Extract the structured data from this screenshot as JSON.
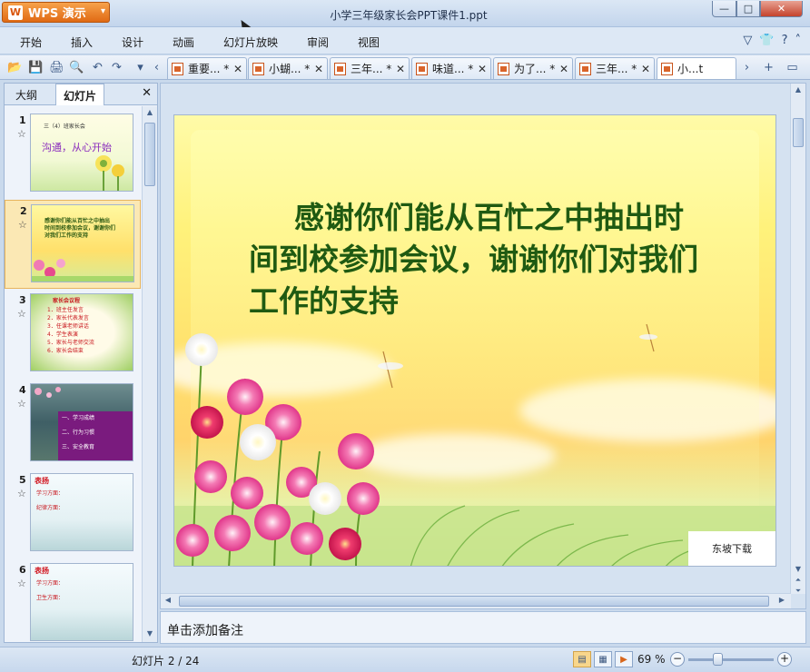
{
  "window": {
    "app_button": "WPS 演示",
    "app_logo": "W",
    "title": "小学三年级家长会PPT课件1.ppt",
    "min_glyph": "—",
    "max_glyph": "□",
    "close_glyph": "✕"
  },
  "menu": {
    "items": [
      "开始",
      "插入",
      "设计",
      "动画",
      "幻灯片放映",
      "审阅",
      "视图"
    ],
    "right_icons": [
      "dropdown-icon",
      "shirt-skin-icon",
      "help-icon",
      "caret-icon"
    ]
  },
  "toolbar": {
    "tabs": [
      {
        "label": "重要... *",
        "active": false
      },
      {
        "label": "小蝴... *",
        "active": false
      },
      {
        "label": "三年... *",
        "active": false
      },
      {
        "label": "味道... *",
        "active": false
      },
      {
        "label": "为了... *",
        "active": false
      },
      {
        "label": "三年... *",
        "active": false
      },
      {
        "label": "小...t",
        "active": true
      }
    ],
    "close_glyph": "✕"
  },
  "panel": {
    "tab_outline": "大纲",
    "tab_slides": "幻灯片",
    "close_glyph": "✕",
    "thumbnails": [
      {
        "num": "1",
        "lines": [
          "三（4）班家长会",
          "沟通，从心开始"
        ]
      },
      {
        "num": "2",
        "lines": [
          "感谢你们能从百忙之中抽出",
          "时间到校参加会议，谢谢你们",
          "对我们工作的支持"
        ]
      },
      {
        "num": "3",
        "lines": [
          "家长会议程",
          "1．班主任发言",
          "2．家长代表发言",
          "3．任课老师讲话",
          "4．学生表演",
          "5．家长与老师交流",
          "6．家长会结束"
        ]
      },
      {
        "num": "4",
        "lines": [
          "一、学习成绩",
          "二、行为习惯",
          "三、安全教育"
        ]
      },
      {
        "num": "5",
        "lines": [
          "表扬",
          "学习方面：",
          "纪律方面："
        ]
      },
      {
        "num": "6",
        "lines": [
          "表扬",
          "学习方面：",
          "卫生方面："
        ]
      }
    ]
  },
  "slide": {
    "title": "感谢你们能从百忙之中抽出时间到校参加会议，谢谢你们对我们工作的支持",
    "watermark": "东坡下载"
  },
  "notes": {
    "placeholder": "单击添加备注"
  },
  "status": {
    "slide_counter": "幻灯片 2 / 24",
    "zoom": "69 %",
    "zoom_fraction": 0.33
  }
}
